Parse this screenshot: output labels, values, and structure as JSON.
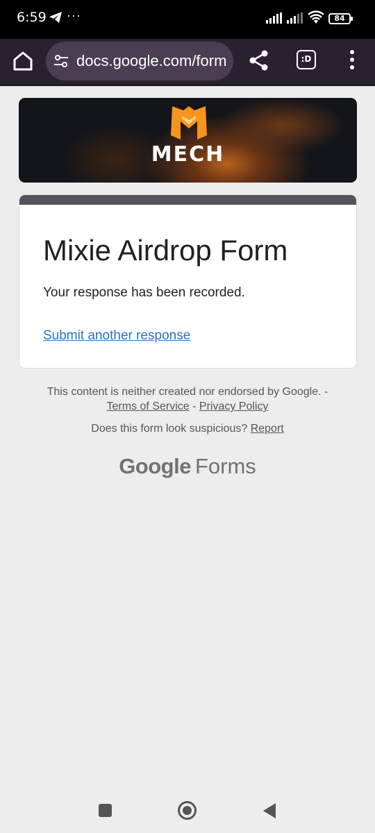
{
  "status_bar": {
    "time": "6:59",
    "overflow": "···",
    "battery": "84",
    "icons": [
      "telegram-icon",
      "signal-icon",
      "signal-icon",
      "wifi-icon",
      "battery-icon"
    ]
  },
  "browser": {
    "url": "docs.google.com/form",
    "tabs_label": ":D",
    "icons": [
      "home-icon",
      "tune-icon",
      "share-icon",
      "more-vert-icon"
    ]
  },
  "banner": {
    "brand": "MECH",
    "logo_letter_color": "#f7941d"
  },
  "form": {
    "title": "Mixie Airdrop Form",
    "confirmation": "Your response has been recorded.",
    "another_link": "Submit another response",
    "accent_color": "#55545a"
  },
  "footer": {
    "disclaimer": "This content is neither created nor endorsed by Google. -",
    "terms": "Terms of Service",
    "sep": " - ",
    "privacy": "Privacy Policy",
    "suspicious": "Does this form look suspicious?",
    "report": "Report",
    "brand_google": "Google",
    "brand_forms": "Forms"
  },
  "nav": {
    "icons": [
      "recents-icon",
      "home-icon",
      "back-icon"
    ]
  }
}
